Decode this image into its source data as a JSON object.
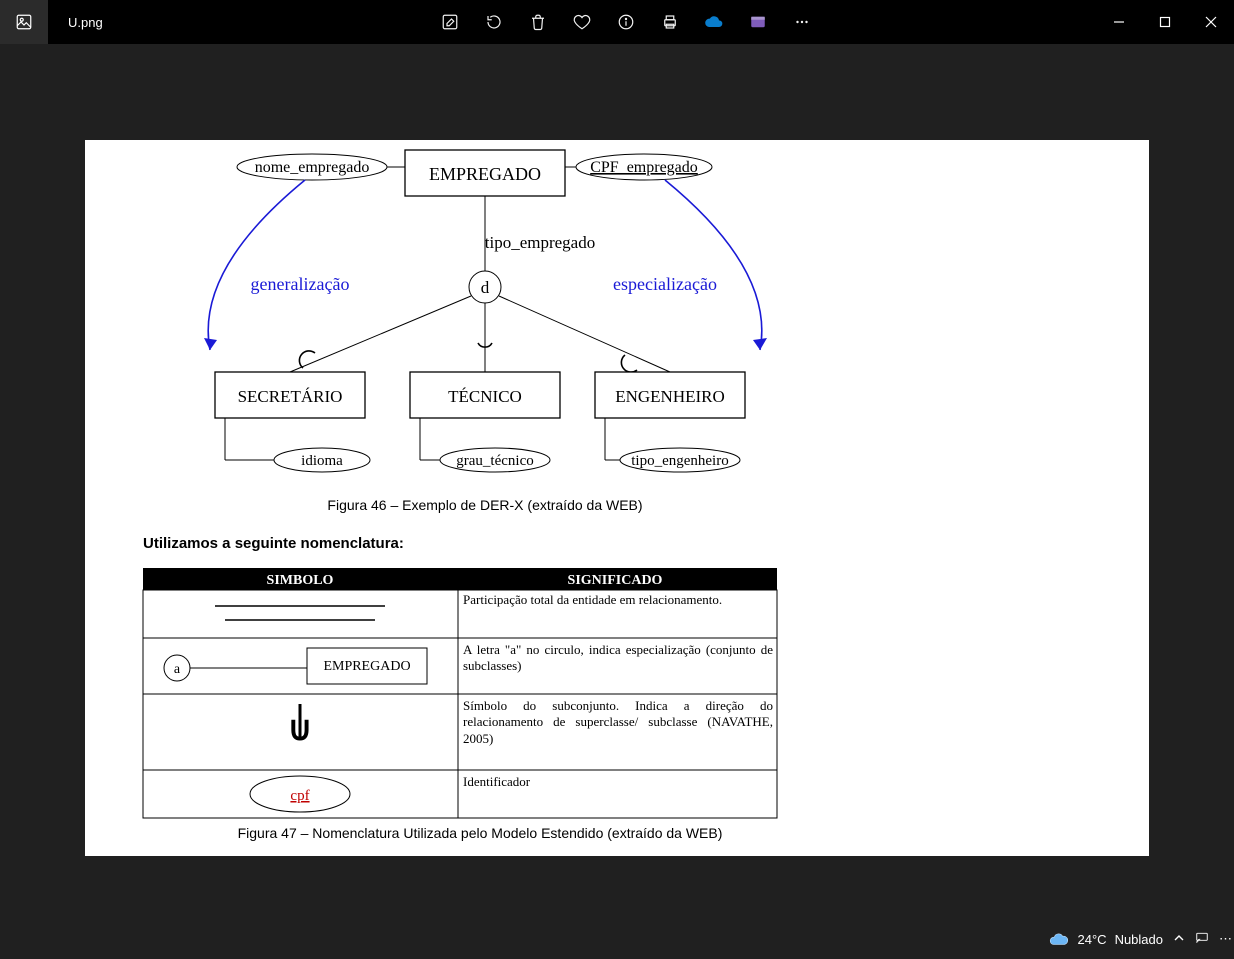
{
  "titlebar": {
    "filename": "U.png",
    "tools": [
      "edit-image-icon",
      "rotate-icon",
      "delete-icon",
      "favorite-icon",
      "info-icon",
      "print-icon",
      "onedrive-icon",
      "clipchamp-icon",
      "more-icon"
    ],
    "window": [
      "minimize",
      "maximize",
      "close"
    ]
  },
  "document": {
    "diagram": {
      "entity_super": "EMPREGADO",
      "attr_left": "nome_empregado",
      "attr_right": "CPF_empregado",
      "discriminator_label": "tipo_empregado",
      "disc": "d",
      "generalization": "generalização",
      "specialization": "especialização",
      "sub": [
        {
          "name": "SECRETÁRIO",
          "attr": "idioma"
        },
        {
          "name": "TÉCNICO",
          "attr": "grau_técnico"
        },
        {
          "name": "ENGENHEIRO",
          "attr": "tipo_engenheiro"
        }
      ]
    },
    "caption1": "Figura 46 – Exemplo de DER-X (extraído da WEB)",
    "section_heading": "Utilizamos a seguinte nomenclatura:",
    "table": {
      "head": [
        "SIMBOLO",
        "SIGNIFICADO"
      ],
      "rows": [
        {
          "significado": "Participação total da entidade em relacionamento."
        },
        {
          "simbolo_letter": "a",
          "simbolo_entity": "EMPREGADO",
          "significado": "A letra \"a\" no circulo, indica especialização (conjunto de subclasses)"
        },
        {
          "simbolo_glyph": "U",
          "significado": "Símbolo do subconjunto. Indica a direção do relacionamento de superclasse/ subclasse (NAVATHE, 2005)"
        },
        {
          "simbolo_oval": "cpf",
          "significado": "Identificador"
        }
      ]
    },
    "caption2": "Figura 47 – Nomenclatura Utilizada pelo Modelo Estendido (extraído da WEB)"
  },
  "taskbar": {
    "weather_temp": "24°C",
    "weather_cond": "Nublado"
  }
}
